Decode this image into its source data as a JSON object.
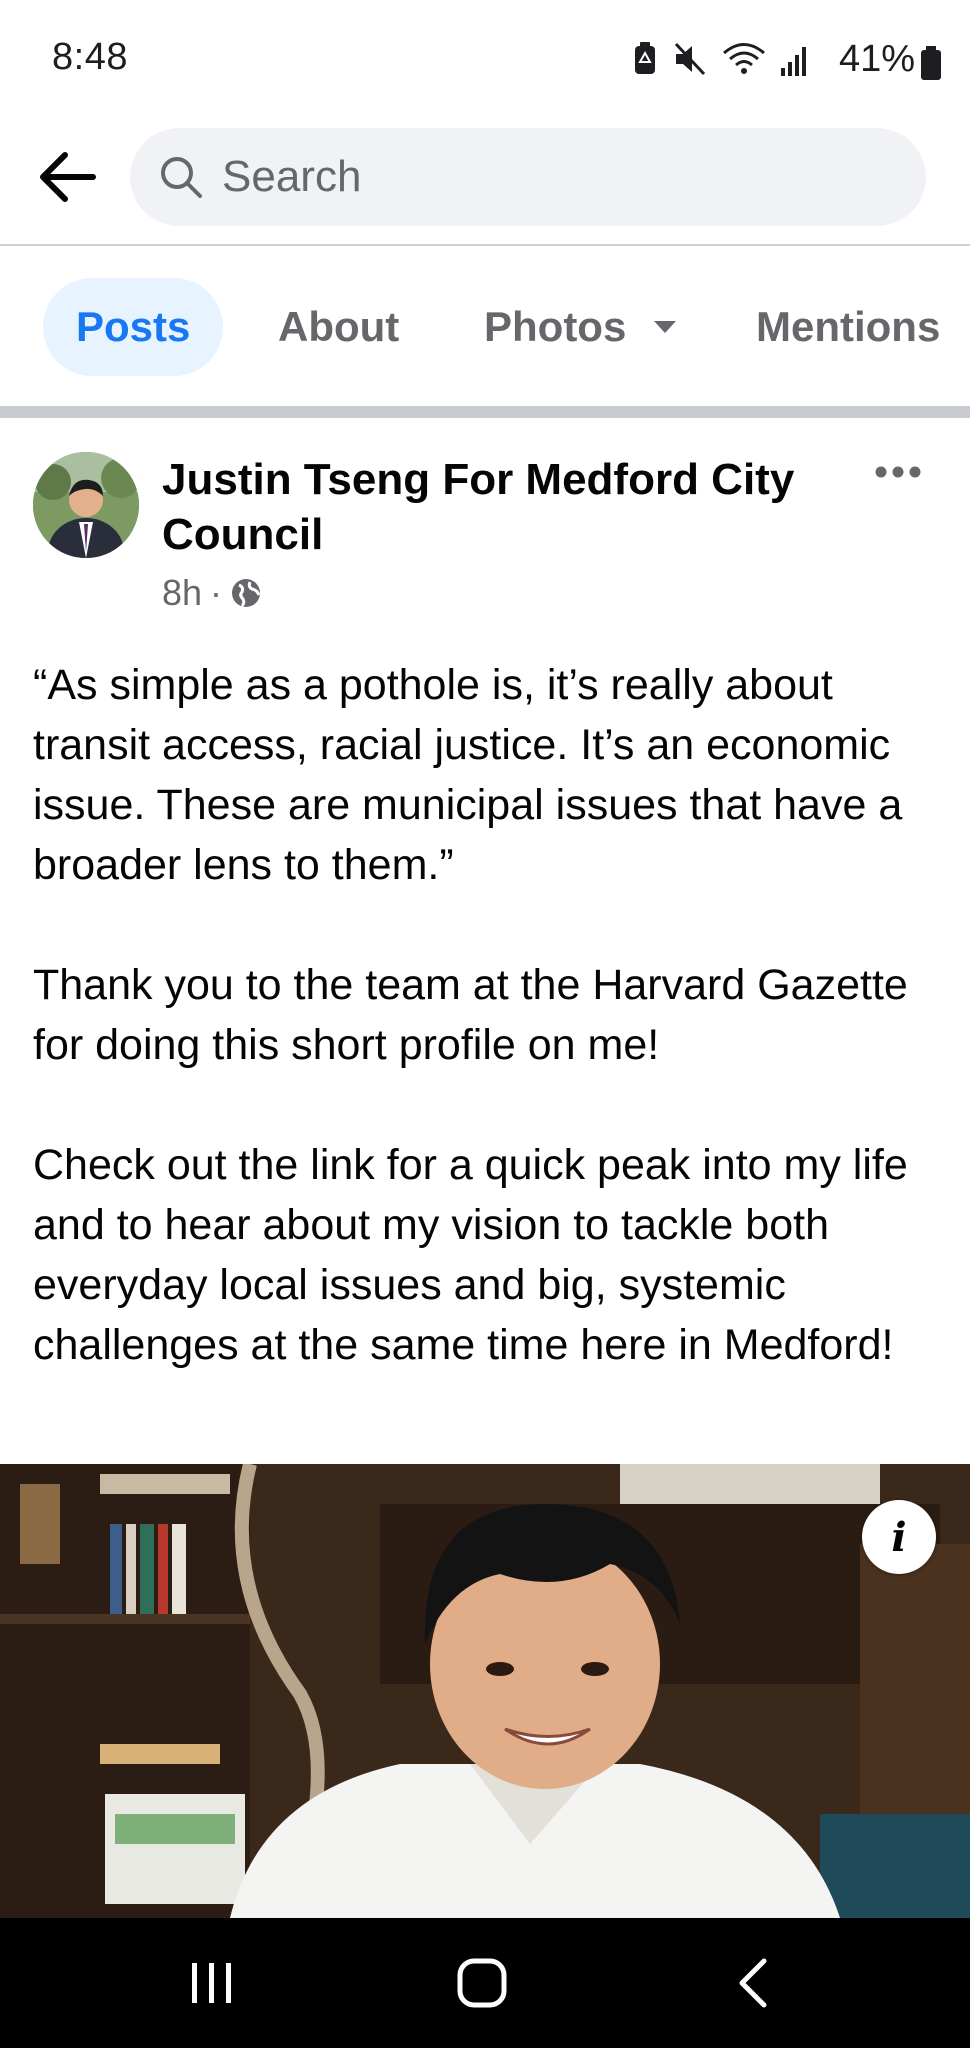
{
  "status_bar": {
    "time": "8:48",
    "battery": "41%",
    "icons": [
      "battery-saver-icon",
      "mute-icon",
      "wifi-icon",
      "signal-icon",
      "battery-icon"
    ]
  },
  "search": {
    "placeholder": "Search",
    "value": ""
  },
  "tabs": [
    {
      "label": "Posts",
      "active": true
    },
    {
      "label": "About",
      "active": false
    },
    {
      "label": "Photos",
      "active": false
    },
    {
      "label": "Mentions",
      "active": false
    }
  ],
  "post": {
    "author": "Justin Tseng For Medford City Council",
    "time": "8h",
    "privacy_icon": "globe-icon",
    "paragraphs": [
      "“As simple as a pothole is, it’s really about transit access, racial justice. It’s an economic issue. These are municipal issues that have a broader lens to them.”",
      "Thank you to the team at the Harvard Gazette for doing this short profile on me!",
      "Check out the link for a quick peak into my life and to hear about my vision to tackle both everyday local issues and big, systemic challenges at the same time here in Medford!"
    ],
    "info_label": "i"
  },
  "colors": {
    "accent": "#1877f2",
    "active_tab_bg": "#e7f3ff",
    "secondary_text": "#65676b",
    "search_bg": "#f0f2f5"
  }
}
